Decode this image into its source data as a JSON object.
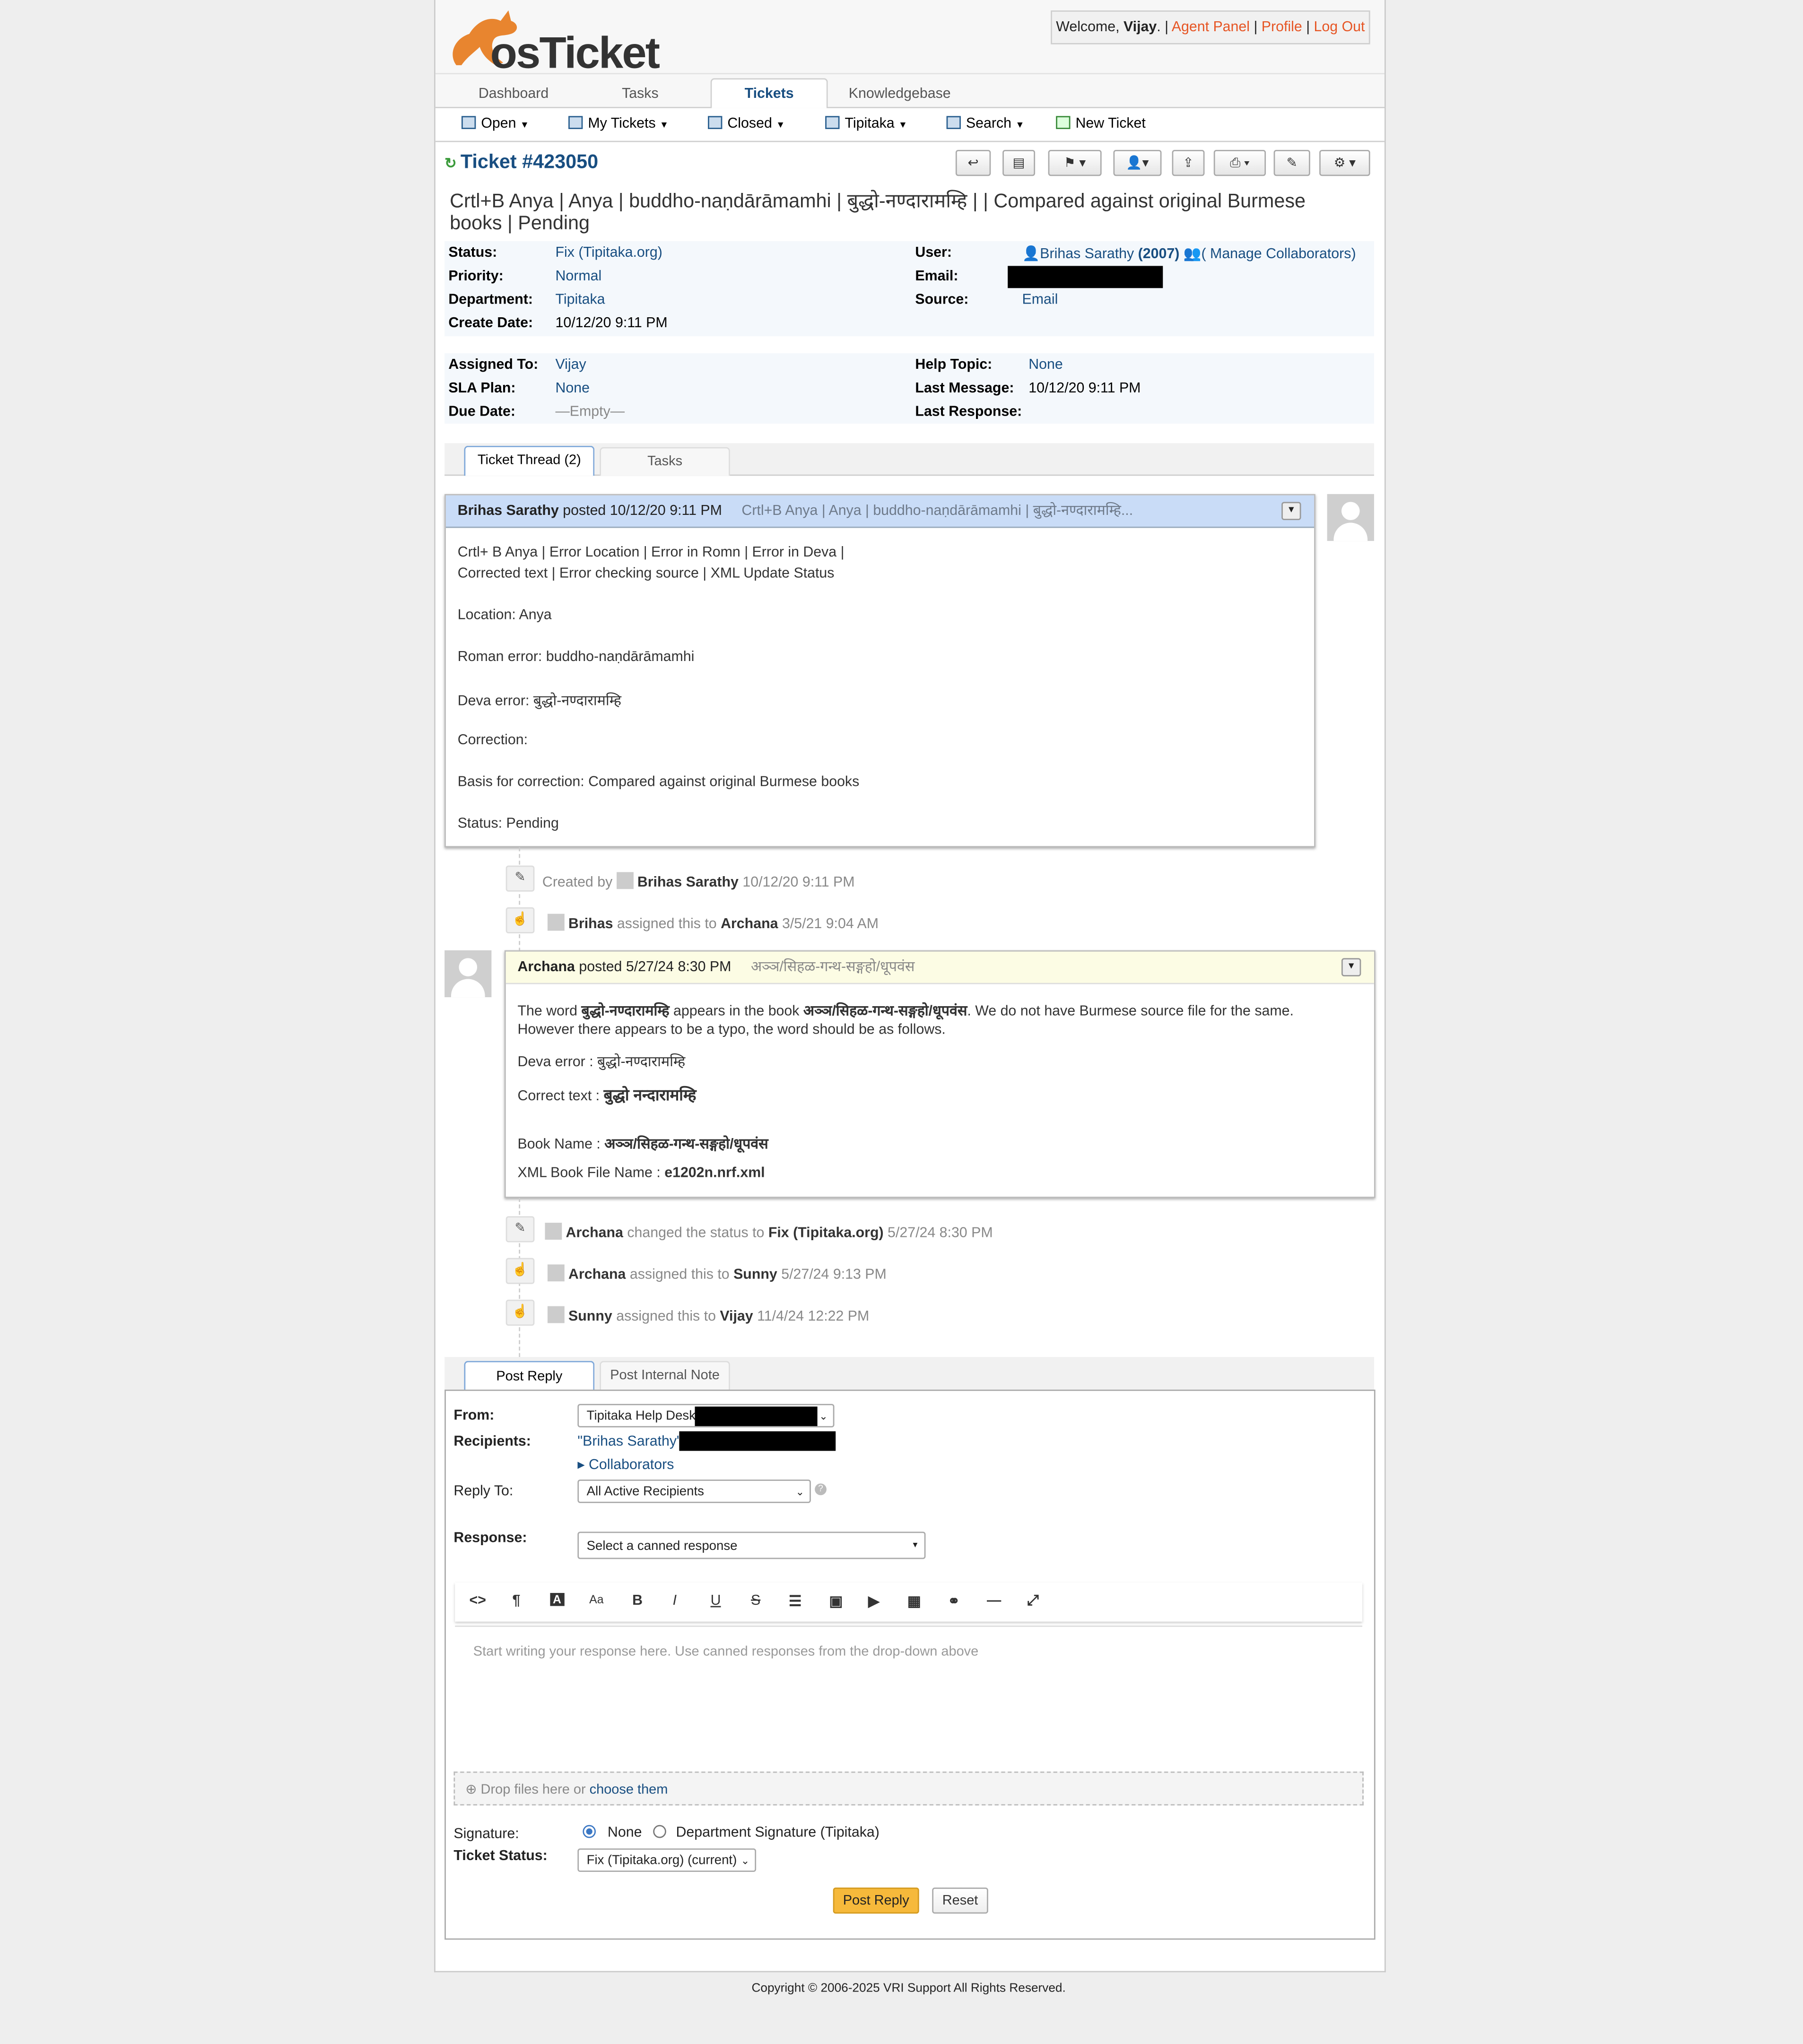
{
  "header": {
    "logo_text": "osTicket",
    "welcome_prefix": "Welcome, ",
    "user_name": "Vijay",
    "agent_panel": "Agent Panel",
    "profile": "Profile",
    "logout": "Log Out"
  },
  "nav": {
    "tabs": [
      "Dashboard",
      "Tasks",
      "Tickets",
      "Knowledgebase"
    ],
    "active": "Tickets"
  },
  "subnav": [
    "Open",
    "My Tickets",
    "Closed",
    "Tipitaka",
    "Search",
    "New Ticket"
  ],
  "ticket": {
    "number": "Ticket #423050",
    "subject": "Crtl+B Anya | Anya | buddho-naṇdārāmamhi | बुद्धो-नण्दारामम्हि | | Compared against original Burmese books | Pending",
    "status_label": "Status:",
    "status": "Fix (Tipitaka.org)",
    "priority_label": "Priority:",
    "priority": "Normal",
    "department_label": "Department:",
    "department": "Tipitaka",
    "create_date_label": "Create Date:",
    "create_date": "10/12/20 9:11 PM",
    "user_label": "User:",
    "user": "Brihas Sarathy",
    "user_count": "(2007)",
    "manage_collaborators": "( Manage Collaborators)",
    "email_label": "Email:",
    "source_label": "Source:",
    "source": "Email",
    "assigned_label": "Assigned To:",
    "assigned": "Vijay",
    "sla_label": "SLA Plan:",
    "sla": "None",
    "due_label": "Due Date:",
    "due": "—Empty—",
    "help_topic_label": "Help Topic:",
    "help_topic": "None",
    "last_message_label": "Last Message:",
    "last_message": "10/12/20 9:11 PM",
    "last_response_label": "Last Response:"
  },
  "thread_tabs": [
    "Ticket Thread (2)",
    "Tasks"
  ],
  "entry1": {
    "author": "Brihas Sarathy",
    "posted": "posted 10/12/20 9:11 PM",
    "title": "Crtl+B Anya | Anya | buddho-naṇdārāmamhi | बुद्धो-नण्दारामम्हि...",
    "lines": [
      "Crtl+ B Anya | Error Location | Error in Romn | Error in Deva |",
      "Corrected text | Error checking source | XML Update Status",
      "Location: Anya",
      "Roman error: buddho-naṇdārāmamhi",
      "Deva error: बुद्धो-नण्दारामम्हि",
      "Correction:",
      "Basis for correction: Compared against original Burmese books",
      "Status: Pending"
    ]
  },
  "events1": [
    {
      "prefix": "Created by",
      "who": "Brihas Sarathy",
      "rest": "10/12/20 9:11 PM"
    },
    {
      "who": "Brihas",
      "mid": "assigned this to",
      "target": "Archana",
      "rest": "3/5/21 9:04 AM"
    }
  ],
  "entry2": {
    "author": "Archana",
    "posted": "posted 5/27/24 8:30 PM",
    "title": "अञ्ञ/सिहळ-गन्थ-सङ्गहो/धूपवंस",
    "l1_a": "The word ",
    "l1_b": "बुद्धो-नण्दारामम्हि",
    "l1_c": " appears in the book ",
    "l1_d": "अञ्ञ/सिहळ-गन्थ-सङ्गहो/धूपवंस",
    "l1_e": ". We do not have Burmese source file for the same.",
    "l2": "However there appears to be a typo, the word should be as follows.",
    "deva_error": "Deva error : बुद्धो-नण्दारामम्हि",
    "correct_label": "Correct text : ",
    "correct_value": "बुद्धो नन्दारामम्हि",
    "book_label": "Book Name : ",
    "book_value": "अञ्ञ/सिहळ-गन्थ-सङ्गहो/धूपवंस",
    "xml_label": "XML Book File Name : ",
    "xml_value": "e1202n.nrf.xml"
  },
  "events2": [
    {
      "who": "Archana",
      "mid": "changed the status to",
      "target": "Fix (Tipitaka.org)",
      "rest": "5/27/24 8:30 PM"
    },
    {
      "who": "Archana",
      "mid": "assigned this to",
      "target": "Sunny",
      "rest": "5/27/24 9:13 PM"
    },
    {
      "who": "Sunny",
      "mid": "assigned this to",
      "target": "Vijay",
      "rest": "11/4/24 12:22 PM"
    }
  ],
  "reply": {
    "tabs": [
      "Post Reply",
      "Post Internal Note"
    ],
    "from_label": "From:",
    "from_value": "Tipitaka Help Desk",
    "recipients_label": "Recipients:",
    "recipients_value": "\"Brihas Sarathy\"",
    "collaborators": "Collaborators",
    "reply_to_label": "Reply To:",
    "reply_to_value": "All Active Recipients",
    "response_label": "Response:",
    "response_value": "Select a canned response",
    "editor_placeholder": "Start writing your response here. Use canned responses from the drop-down above",
    "drop_text": "Drop files here or ",
    "drop_link": "choose them",
    "signature_label": "Signature:",
    "sig_none": "None",
    "sig_dept": "Department Signature (Tipitaka)",
    "status_label": "Ticket Status:",
    "status_value": "Fix (Tipitaka.org) (current)",
    "post_button": "Post Reply",
    "reset_button": "Reset"
  },
  "toolbar_icons": [
    "code-view-icon",
    "paragraph-icon",
    "font-color-icon",
    "font-size-icon",
    "bold-icon",
    "italic-icon",
    "underline-icon",
    "strikethrough-icon",
    "list-icon",
    "image-icon",
    "video-icon",
    "table-icon",
    "link-icon",
    "horizontal-rule-icon",
    "fullscreen-icon"
  ],
  "footer": "Copyright © 2006-2025 VRI Support All Rights Reserved.",
  "colors": {
    "link": "#184E81",
    "accent_orange": "#e65524",
    "entry1_header": "#c9dcf7",
    "entry2_header": "#fcfce4",
    "post_button": "#f6b93b"
  }
}
